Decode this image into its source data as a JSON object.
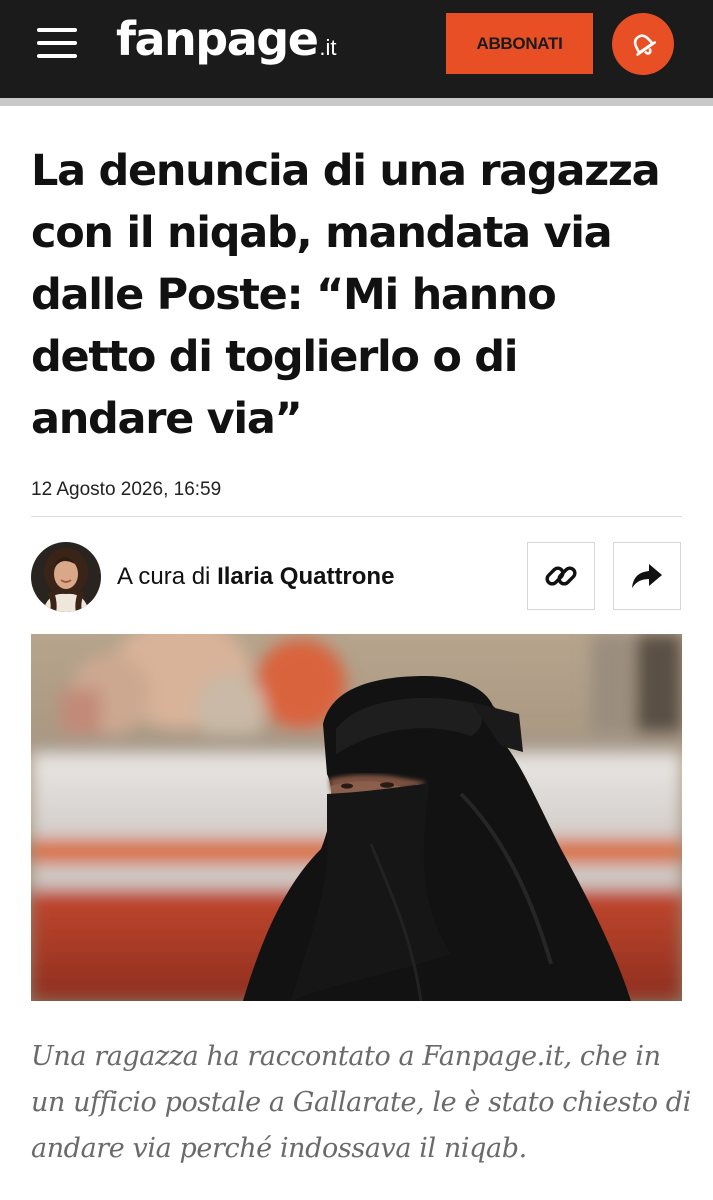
{
  "header": {
    "logo_main": "fanpage",
    "logo_suffix": ".it",
    "subscribe_label": "ABBONATI",
    "icons": {
      "menu": "hamburger-menu-icon",
      "notification": "bell-icon"
    },
    "colors": {
      "bar": "#1b1b1b",
      "accent": "#e84f25"
    }
  },
  "article": {
    "title": "La denuncia di una ragazza con il niqab, mandata via dalle Poste: “Mi hanno detto di toglierlo o di andare via”",
    "date": "12 Agosto 2026, 16:59",
    "author": {
      "prefix": "A cura di",
      "name": "Ilaria Quattrone"
    },
    "actions": {
      "copy_link_icon": "link-icon",
      "share_icon": "share-arrow-icon"
    },
    "caption": "Una ragazza ha raccontato a Fanpage.it, che in un ufficio postale a Gallarate, le è stato chiesto di andare via perché indossava il niqab."
  }
}
